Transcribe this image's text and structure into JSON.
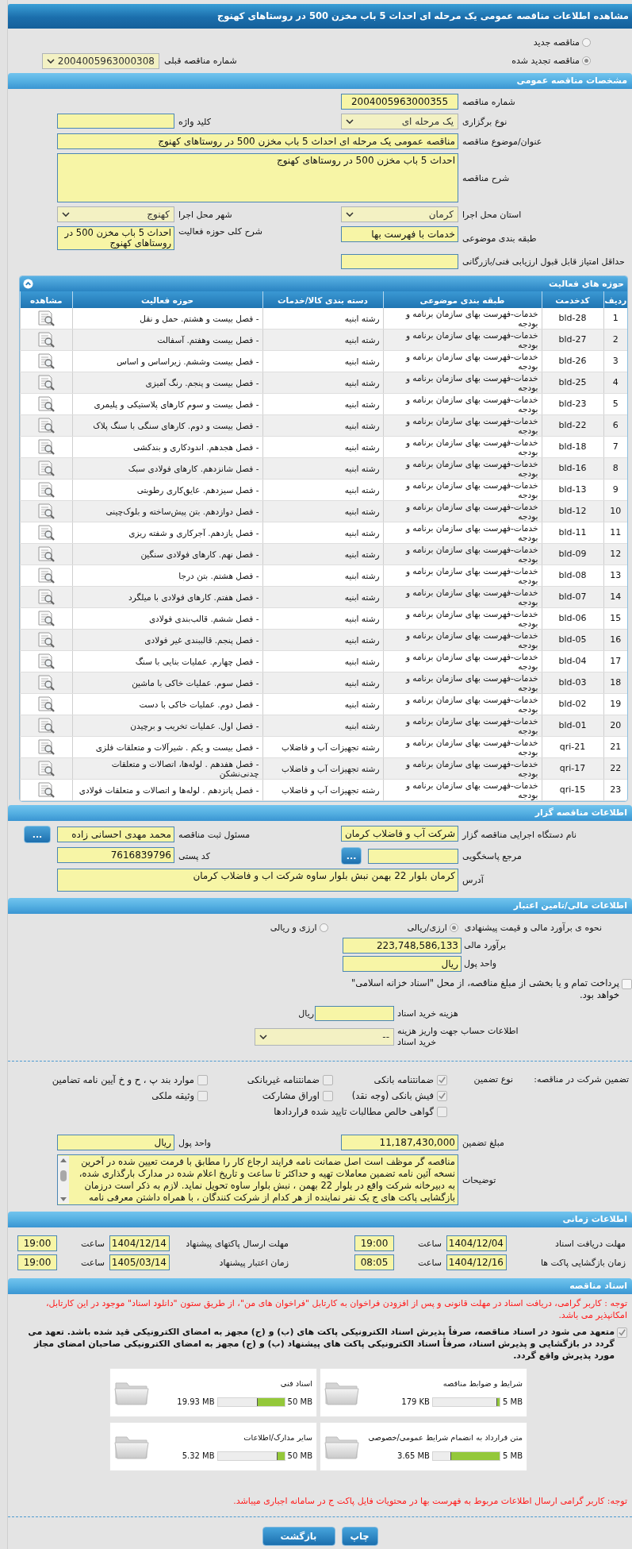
{
  "title": "مشاهده اطلاعات مناقصه عمومی یک مرحله ای احداث 5 باب مخزن 500 در روستاهای کهنوج",
  "tender_kind": [
    {
      "label": "مناقصه جدید",
      "selected": false
    },
    {
      "label": "مناقصه تجدید شده",
      "selected": true
    }
  ],
  "previous_number": {
    "label": "شماره مناقصه قبلی",
    "value": "2004005963000308"
  },
  "general": {
    "header": "مشخصات مناقصه عمومی",
    "rows": [
      [
        {
          "label": "شماره مناقصه",
          "value": "2004005963000355",
          "kind": "number"
        }
      ],
      [
        {
          "label": "نوع برگزاری",
          "value": "یک مرحله ای",
          "kind": "select"
        },
        {
          "label": "کلید واژه",
          "kind": "input"
        }
      ],
      [
        {
          "label": "عنوان/موضوع مناقصه",
          "value": "مناقصه عمومی یک مرحله ای احداث 5 باب مخزن 500 در روستاهای کهنوج",
          "kind": "wide"
        }
      ],
      [
        {
          "label": "شرح مناقصه",
          "value": "احداث 5 باب مخزن 500 در روستاهای کهنوج",
          "kind": "area"
        }
      ],
      [
        {
          "label": "استان محل اجرا",
          "value": "کرمان",
          "kind": "select"
        },
        {
          "label": "شهر محل اجرا",
          "value": "کهنوج",
          "kind": "select"
        }
      ],
      [
        {
          "label": "طبقه بندی موضوعی",
          "value": "خدمات با فهرست بها",
          "kind": "input"
        },
        {
          "label": "شرح کلی حوزه فعالیت",
          "value": "احداث 5 باب مخزن 500 در روستاهای کهنوج",
          "kind": "note"
        }
      ],
      [
        {
          "label": "حداقل امتیاز قابل قبول ارزیابی فنی/بازرگانی",
          "kind": "input"
        }
      ]
    ]
  },
  "activities": {
    "header": "حوزه های فعالیت",
    "columns": [
      "ردیف",
      "کدخدمت",
      "طبقه بندی موضوعی",
      "دسته بندی کالا/خدمات",
      "حوزه فعالیت",
      "مشاهده"
    ],
    "rows": [
      {
        "row": "1",
        "code": "bld-28",
        "category": "خدمات-فهرست بهای سازمان برنامه و بودجه",
        "group": "رشته ابنیه",
        "activity": "- فصل بیست و هشتم. حمل و نقل"
      },
      {
        "row": "2",
        "code": "bld-27",
        "category": "خدمات-فهرست بهای سازمان برنامه و بودجه",
        "group": "رشته ابنیه",
        "activity": "- فصل بیست وهفتم. آسفالت"
      },
      {
        "row": "3",
        "code": "bld-26",
        "category": "خدمات-فهرست بهای سازمان برنامه و بودجه",
        "group": "رشته ابنیه",
        "activity": "- فصل بیست وششم. زیراساس و اساس"
      },
      {
        "row": "4",
        "code": "bld-25",
        "category": "خدمات-فهرست بهای سازمان برنامه و بودجه",
        "group": "رشته ابنیه",
        "activity": "- فصل بیست و پنجم. رنگ آمیزی"
      },
      {
        "row": "5",
        "code": "bld-23",
        "category": "خدمات-فهرست بهای سازمان برنامه و بودجه",
        "group": "رشته ابنیه",
        "activity": "- فصل بیست و سوم کارهای پلاستیکی و پلیمری"
      },
      {
        "row": "6",
        "code": "bld-22",
        "category": "خدمات-فهرست بهای سازمان برنامه و بودجه",
        "group": "رشته ابنیه",
        "activity": "- فصل بیست و دوم. کارهای سنگی با سنگ پلاک"
      },
      {
        "row": "7",
        "code": "bld-18",
        "category": "خدمات-فهرست بهای سازمان برنامه و بودجه",
        "group": "رشته ابنیه",
        "activity": "- فصل هجدهم. اندودکاری و بندکشی"
      },
      {
        "row": "8",
        "code": "bld-16",
        "category": "خدمات-فهرست بهای سازمان برنامه و بودجه",
        "group": "رشته ابنیه",
        "activity": "- فصل شانزدهم. کارهای فولادی سبک"
      },
      {
        "row": "9",
        "code": "bld-13",
        "category": "خدمات-فهرست بهای سازمان برنامه و بودجه",
        "group": "رشته ابنیه",
        "activity": "- فصل سیزدهم. عایق‌کاری رطوبتی"
      },
      {
        "row": "10",
        "code": "bld-12",
        "category": "خدمات-فهرست بهای سازمان برنامه و بودجه",
        "group": "رشته ابنیه",
        "activity": "- فصل دوازدهم. بتن پیش‌ساخته و بلوک‌چینی"
      },
      {
        "row": "11",
        "code": "bld-11",
        "category": "خدمات-فهرست بهای سازمان برنامه و بودجه",
        "group": "رشته ابنیه",
        "activity": "- فصل یازدهم. آجرکاری و شفته ریزی"
      },
      {
        "row": "12",
        "code": "bld-09",
        "category": "خدمات-فهرست بهای سازمان برنامه و بودجه",
        "group": "رشته ابنیه",
        "activity": "- فصل نهم. کارهای فولادی سنگین"
      },
      {
        "row": "13",
        "code": "bld-08",
        "category": "خدمات-فهرست بهای سازمان برنامه و بودجه",
        "group": "رشته ابنیه",
        "activity": "- فصل هشتم. بتن درجا"
      },
      {
        "row": "14",
        "code": "bld-07",
        "category": "خدمات-فهرست بهای سازمان برنامه و بودجه",
        "group": "رشته ابنیه",
        "activity": "- فصل هفتم. کارهای فولادی با میلگرد"
      },
      {
        "row": "15",
        "code": "bld-06",
        "category": "خدمات-فهرست بهای سازمان برنامه و بودجه",
        "group": "رشته ابنیه",
        "activity": "- فصل ششم. قالب‌بندی فولادی"
      },
      {
        "row": "16",
        "code": "bld-05",
        "category": "خدمات-فهرست بهای سازمان برنامه و بودجه",
        "group": "رشته ابنیه",
        "activity": "- فصل پنجم. قالببندی غیر فولادی"
      },
      {
        "row": "17",
        "code": "bld-04",
        "category": "خدمات-فهرست بهای سازمان برنامه و بودجه",
        "group": "رشته ابنیه",
        "activity": "- فصل چهارم. عملیات بنایی با سنگ"
      },
      {
        "row": "18",
        "code": "bld-03",
        "category": "خدمات-فهرست بهای سازمان برنامه و بودجه",
        "group": "رشته ابنیه",
        "activity": "- فصل سوم. عملیات خاکی با ماشین"
      },
      {
        "row": "19",
        "code": "bld-02",
        "category": "خدمات-فهرست بهای سازمان برنامه و بودجه",
        "group": "رشته ابنیه",
        "activity": "- فصل دوم. عملیات خاکی با دست"
      },
      {
        "row": "20",
        "code": "bld-01",
        "category": "خدمات-فهرست بهای سازمان برنامه و بودجه",
        "group": "رشته ابنیه",
        "activity": "- فصل اول. عملیات تخریب و برچیدن"
      },
      {
        "row": "21",
        "code": "qri-21",
        "category": "خدمات-فهرست بهای سازمان برنامه و بودجه",
        "group": "رشته تجهیزات آب و فاضلاب",
        "activity": "- فصل بیست و یکم . شیرآلات و متعلقات فلزی"
      },
      {
        "row": "22",
        "code": "qri-17",
        "category": "خدمات-فهرست بهای سازمان برنامه و بودجه",
        "group": "رشته تجهیزات آب و فاضلاب",
        "activity": "- فصل هفدهم . لوله‌ها، اتصالات و متعلقات چدنی‌نشکن"
      },
      {
        "row": "23",
        "code": "qri-15",
        "category": "خدمات-فهرست بهای سازمان برنامه و بودجه",
        "group": "رشته تجهیزات آب و فاضلاب",
        "activity": "- فصل پانزدهم . لوله‌ها و اتصالات و متعلقات فولادی"
      }
    ]
  },
  "organizer": {
    "header": "اطلاعات مناقصه گزار",
    "rows": [
      [
        {
          "label": "نام دستگاه اجرایی مناقصه گزار",
          "value": "شرکت آب و فاضلاب کرمان",
          "kind": "input"
        },
        {
          "label": "مسئول ثبت مناقصه",
          "value": "محمد مهدی احسانی زاده",
          "kind": "input",
          "button": "..."
        }
      ],
      [
        {
          "label": "مرجع پاسخگویی",
          "kind": "input",
          "button": "..."
        },
        {
          "label": "کد پستی",
          "value": "7616839796",
          "kind": "input"
        }
      ],
      [
        {
          "label": "آدرس",
          "value": "کرمان بلوار 22 بهمن نبش بلوار ساوه شرکت اب و فاضلاب کرمان",
          "kind": "address"
        }
      ]
    ]
  },
  "finance": {
    "header": "اطلاعات مالی/تامین اعتبار",
    "method": {
      "label": "نحوه ی برآورد مالی و قیمت پیشنهادی",
      "options": [
        {
          "label": "ارزی/ریالی",
          "selected": true
        },
        {
          "label": "ارزی و ریالی",
          "selected": false
        }
      ]
    },
    "estimate": {
      "label": "برآورد مالی",
      "value": "223,748,586,133"
    },
    "currency": {
      "label": "واحد پول",
      "value": "ریال"
    },
    "treasury": {
      "checked": false,
      "text": "پرداخت تمام و یا بخشی از مبلغ مناقصه، از محل \"اسناد خزانه اسلامی\" خواهد بود."
    },
    "doc_fee": {
      "label": "هزینه خرید اسناد",
      "unit": "ریال"
    },
    "account": {
      "label": "اطلاعات حساب جهت واریز هزینه خرید اسناد",
      "value": "--"
    }
  },
  "guarantee": {
    "label": "تضمین شرکت در مناقصه:",
    "type_label": "نوع تضمین",
    "options": [
      {
        "label": "ضمانتنامه بانکی",
        "checked": true
      },
      {
        "label": "ضمانتنامه غیربانکی",
        "checked": false
      },
      {
        "label": "موارد بند پ ، ح و خ آیین نامه تضامین",
        "checked": false
      },
      {
        "label": "فیش بانکی (وجه نقد)",
        "checked": true
      },
      {
        "label": "اوراق مشارکت",
        "checked": false
      },
      {
        "label": "وثیقه ملکی",
        "checked": false
      },
      {
        "label": "گواهی خالص مطالبات تایید شده قراردادها",
        "checked": false
      }
    ],
    "rows": [
      [
        {
          "label": "مبلغ تضمین",
          "value": "11,187,430,000",
          "kind": "input"
        },
        {
          "label": "واحد پول",
          "value": "ریال",
          "kind": "input"
        }
      ],
      [
        {
          "label": "توضیحات",
          "value": "مناقصه گر موظف است اصل ضمانت نامه فرایند ارجاع کار را مطابق با فرمت تعیین شده در آخرین نسخه آئین نامه تضمین معاملات  تهیه و حداکثر تا ساعت و تاریخ اعلام شده در مدارک بارگذاری شده، به  دبیرخانه شرکت واقع در بلوار 22 بهمن ، نبش بلوار ساوه تحویل نماید. لازم به ذکر است   درزمان بازگشایی پاکت های  ج  یک نفر نماینده از هر کدام از شرکت کنندگان ، با همراه داشتن معرفی نامه",
          "kind": "scroll"
        }
      ]
    ]
  },
  "schedule": {
    "header": "اطلاعات زمانی",
    "items": [
      {
        "label": "مهلت دریافت اسناد",
        "date": "1404/12/04",
        "time_label": "ساعت",
        "time": "19:00"
      },
      {
        "label": "مهلت ارسال پاکتهای پیشنهاد",
        "date": "1404/12/14",
        "time_label": "ساعت",
        "time": "19:00"
      },
      {
        "label": "زمان بازگشایی پاکت ها",
        "date": "1404/12/16",
        "time_label": "ساعت",
        "time": "08:05"
      },
      {
        "label": "زمان اعتبار پیشنهاد",
        "date": "1405/03/14",
        "time_label": "ساعت",
        "time": "19:00"
      }
    ]
  },
  "documents": {
    "header": "اسناد مناقصه",
    "notice": "توجه : کاربر گرامی، دریافت اسناد در مهلت قانونی و پس از افزودن فراخوان به کارتابل \"فراخوان های من\"، از طریق ستون \"دانلود اسناد\" موجود در این کارتابل، امکانپذیر می باشد.",
    "commitment": {
      "checked": true,
      "text": "متعهد می شود در اسناد مناقصه، صرفاً پذیرش اسناد الکترونیکی پاکت های (ب) و (ج) مجهز به امضای الکترونیکی قید شده باشد. تعهد می گردد در بازگشایی و پذیرش اسناد، صرفاً اسناد الکترونیکی پاکت های پیشنهاد (ب) و (ج) مجهز به امضای الکترونیکی صاحبان امضای مجاز مورد پذیرش واقع گردد."
    },
    "files": [
      {
        "title": "شرایط و ضوابط مناقصه",
        "max": "5 MB",
        "size": "179 KB",
        "level": 0.035
      },
      {
        "title": "اسناد فنی",
        "max": "50 MB",
        "size": "19.93 MB",
        "level": 0.4
      },
      {
        "title": "متن قرارداد به انضمام شرایط عمومی/خصوصی",
        "max": "5 MB",
        "size": "3.65 MB",
        "level": 0.73
      },
      {
        "title": "سایر مدارک/اطلاعات",
        "max": "50 MB",
        "size": "5.32 MB",
        "level": 0.106
      }
    ],
    "footer_note": "توجه: کاربر گرامی ارسال اطلاعات مربوط به فهرست بها در محتویات فایل پاکت ج در سامانه اجباری میباشد."
  },
  "buttons": [
    "چاپ",
    "بازگشت"
  ]
}
